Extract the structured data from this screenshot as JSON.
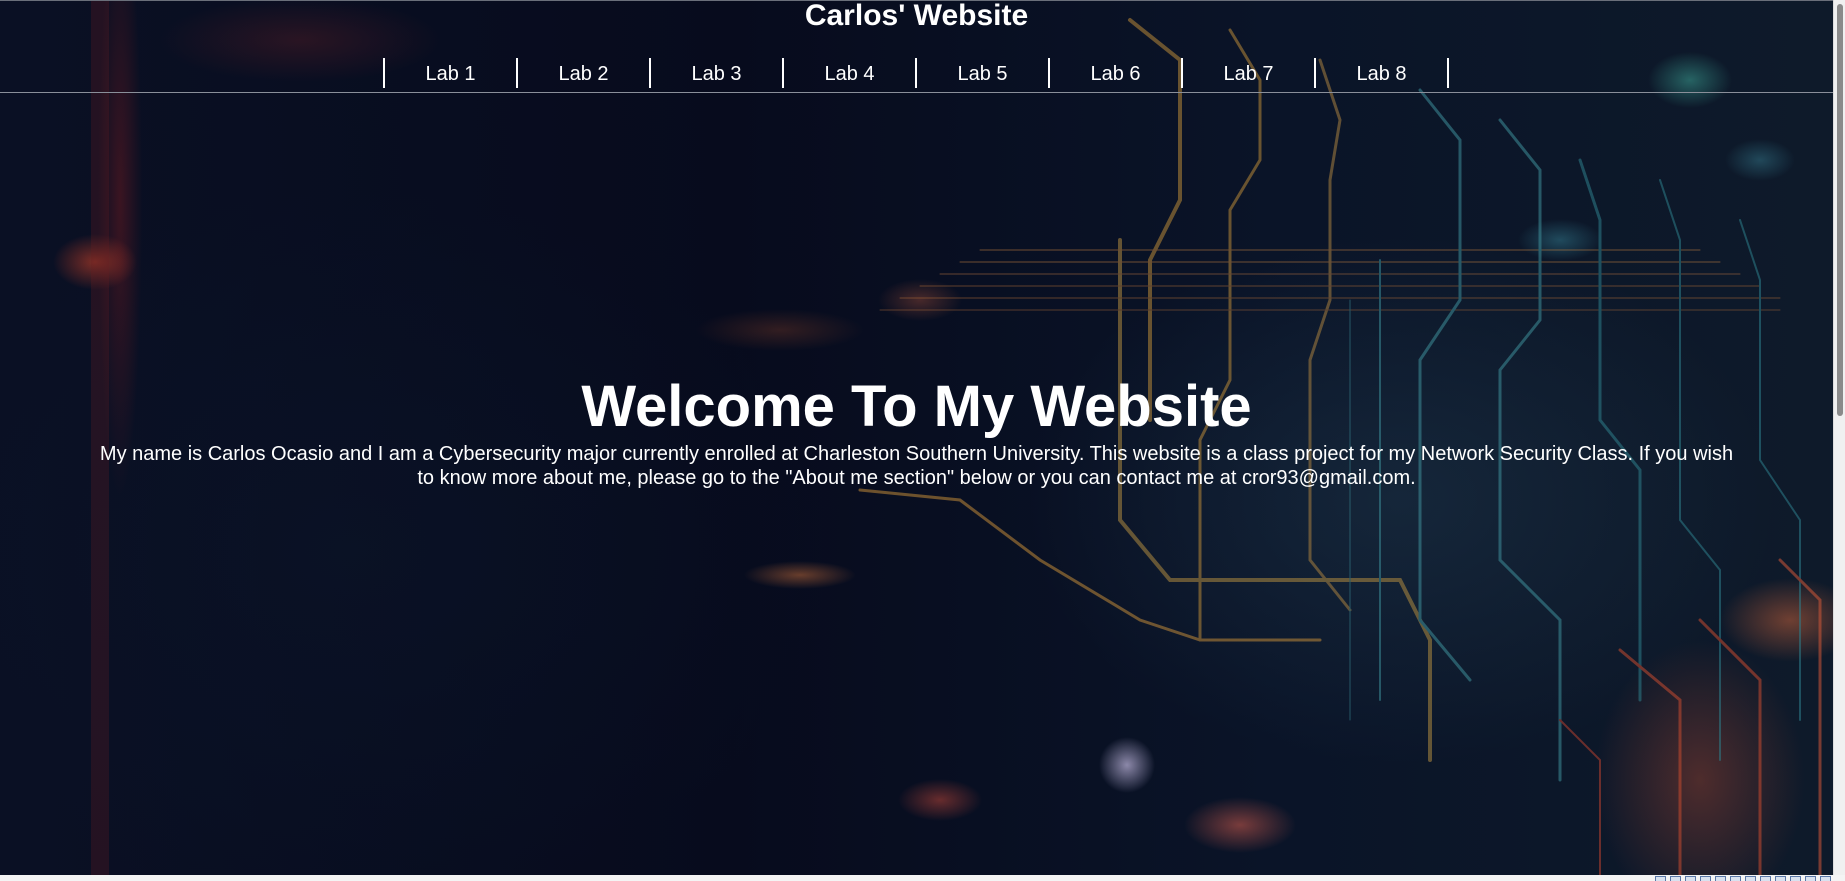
{
  "header": {
    "title": "Carlos' Website",
    "nav": [
      {
        "label": "Lab 1"
      },
      {
        "label": "Lab 2"
      },
      {
        "label": "Lab 3"
      },
      {
        "label": "Lab 4"
      },
      {
        "label": "Lab 5"
      },
      {
        "label": "Lab 6"
      },
      {
        "label": "Lab 7"
      },
      {
        "label": "Lab 8"
      }
    ]
  },
  "hero": {
    "heading": "Welcome To My Website",
    "intro": "My name is Carlos Ocasio and I am a Cybersecurity major currently enrolled at Charleston Southern University. This website is a class project for my Network Security Class. If you wish to know more about me, please go to the \"About me section\" below or you can contact me at cror93@gmail.com."
  },
  "colors": {
    "text": "#ffffff",
    "background": "#050a1c"
  }
}
